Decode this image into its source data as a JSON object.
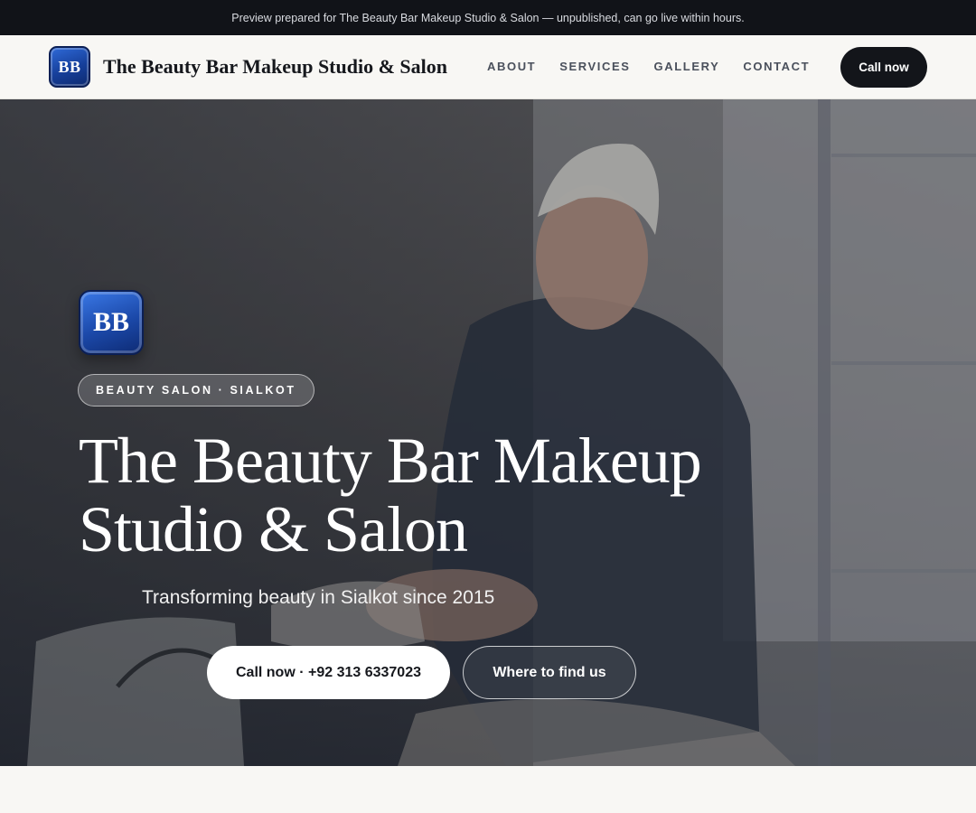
{
  "banner": {
    "text": "Preview prepared for The Beauty Bar Makeup Studio & Salon — unpublished, can go live within hours."
  },
  "header": {
    "logo_initials": "BB",
    "brand_name": "The Beauty Bar Makeup Studio & Salon",
    "nav": [
      {
        "label": "ABOUT"
      },
      {
        "label": "SERVICES"
      },
      {
        "label": "GALLERY"
      },
      {
        "label": "CONTACT"
      }
    ],
    "cta_label": "Call now"
  },
  "hero": {
    "logo_initials": "BB",
    "tag": "BEAUTY SALON · SIALKOT",
    "title": "The Beauty Bar Makeup Studio & Salon",
    "subtitle": "Transforming beauty in Sialkot since 2015",
    "primary_button": "Call now · +92 313 6337023",
    "secondary_button": "Where to find us"
  },
  "colors": {
    "banner_bg": "#111318",
    "header_bg": "#f8f7f4",
    "accent_dark": "#13151a",
    "logo_blue": "#1b48a8"
  }
}
